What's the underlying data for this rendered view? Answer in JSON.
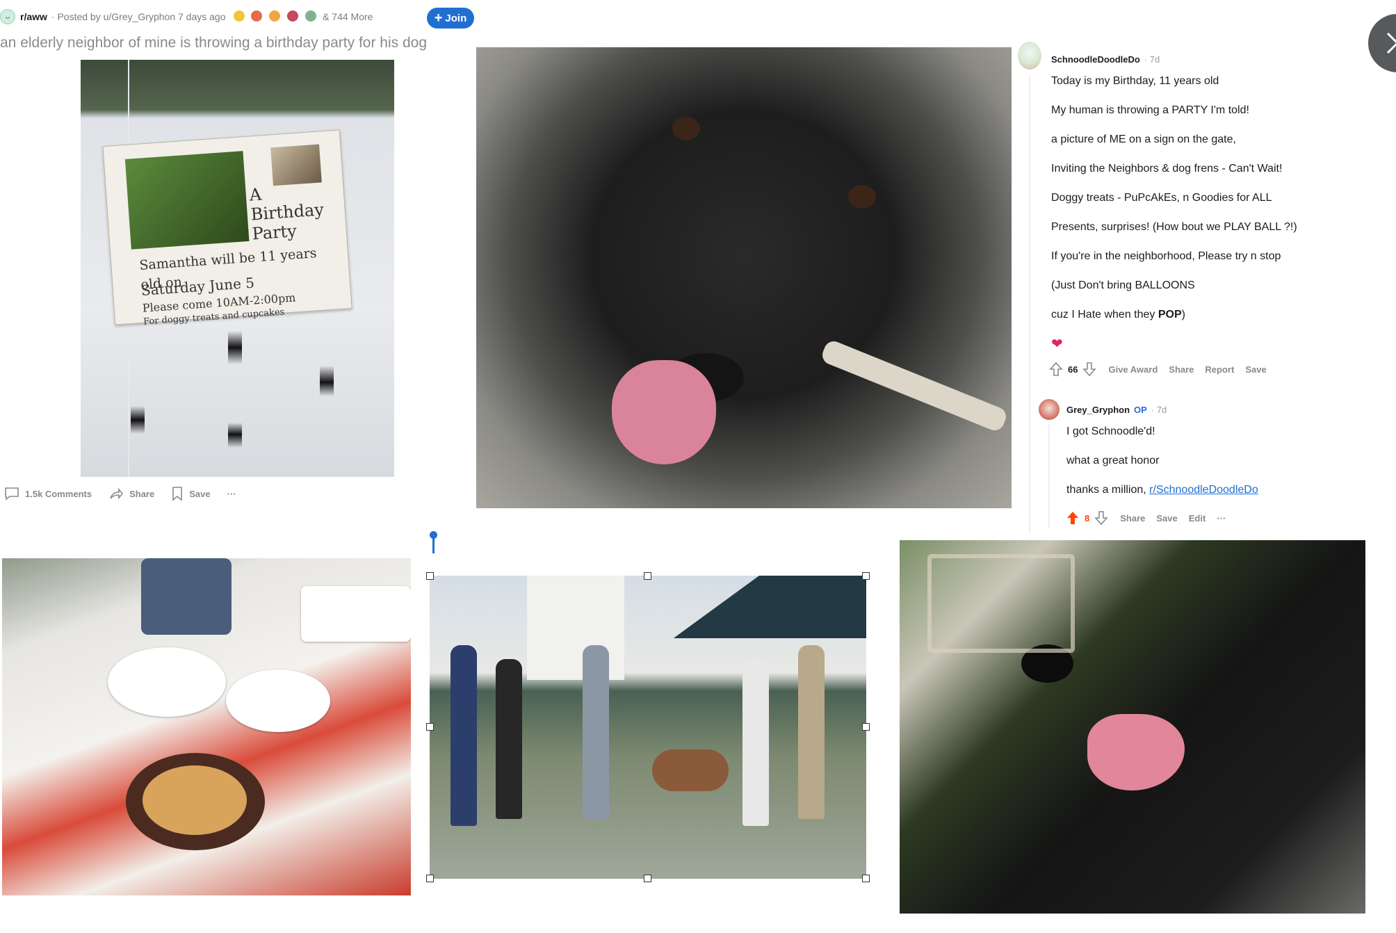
{
  "post": {
    "subreddit": "r/aww",
    "posted_by": "· Posted by u/Grey_Gryphon 7 days ago",
    "awards_more": "& 744 More",
    "join_label": "Join",
    "title": "an elderly neighbor of mine is throwing a birthday party for his dog",
    "sign_text": [
      "A Birthday Party",
      "Samantha will be 11 years old on",
      "Saturday June 5",
      "Please come 10AM-2:00pm",
      "For doggy treats and cupcakes"
    ],
    "actions": {
      "comments": "1.5k Comments",
      "share": "Share",
      "save": "Save",
      "more": "···"
    }
  },
  "comment1": {
    "user": "SchnoodleDoodleDo",
    "age": "· 7d",
    "lines": [
      "Today is my Birthday, 11 years old",
      "My human is throwing a PARTY I'm told!",
      "a picture of ME on a sign on the gate,",
      "Inviting the Neighbors & dog frens - Can't Wait!",
      "Doggy treats - PuPcAkEs, n Goodies for ALL",
      "Presents, surprises! (How bout we PLAY BALL ?!)",
      "If you're in the neighborhood, Please try n stop",
      "(Just Don't bring BALLOONS",
      "cuz I Hate when they ",
      "POP",
      ")"
    ],
    "emoji": "❤",
    "score": "66",
    "actions": [
      "Give Award",
      "Share",
      "Report",
      "Save"
    ]
  },
  "comment2": {
    "user": "Grey_Gryphon",
    "op": "OP",
    "age": "· 7d",
    "lines": [
      "I got Schnoodle'd!",
      "what a great honor",
      "thanks a million, "
    ],
    "link": "r/SchnoodleDoodleDo",
    "score": "8",
    "actions": [
      "Share",
      "Save",
      "Edit",
      "···"
    ]
  },
  "colors": {
    "accent": "#1f6fd1",
    "upvote": "#ff4500",
    "meta": "#878a8c"
  }
}
